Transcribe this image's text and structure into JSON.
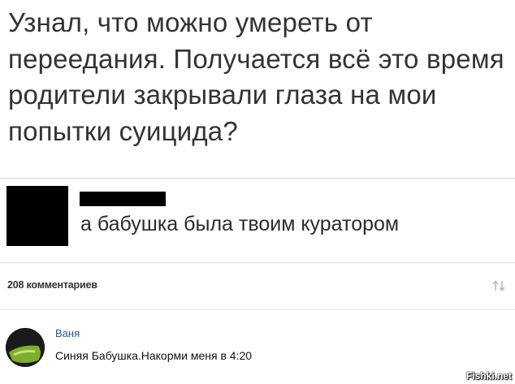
{
  "post": {
    "text": "Узнал, что можно умереть от переедания. Получается всё это время родители закрывали глаза на мои попытки суицида?"
  },
  "reply": {
    "text": "а бабушка была твоим куратором"
  },
  "comments": {
    "count_label": "208 комментариев",
    "items": [
      {
        "author": "Ваня",
        "text": "Синяя Бабушка.Накорми меня в 4:20"
      }
    ]
  },
  "watermark": "Fishki.net",
  "colors": {
    "author_link": "#2a5885",
    "redaction": "#000000",
    "divider": "#d6d6d6"
  },
  "icons": {
    "sort": "sort-arrows-icon",
    "avatar": "avatar"
  }
}
